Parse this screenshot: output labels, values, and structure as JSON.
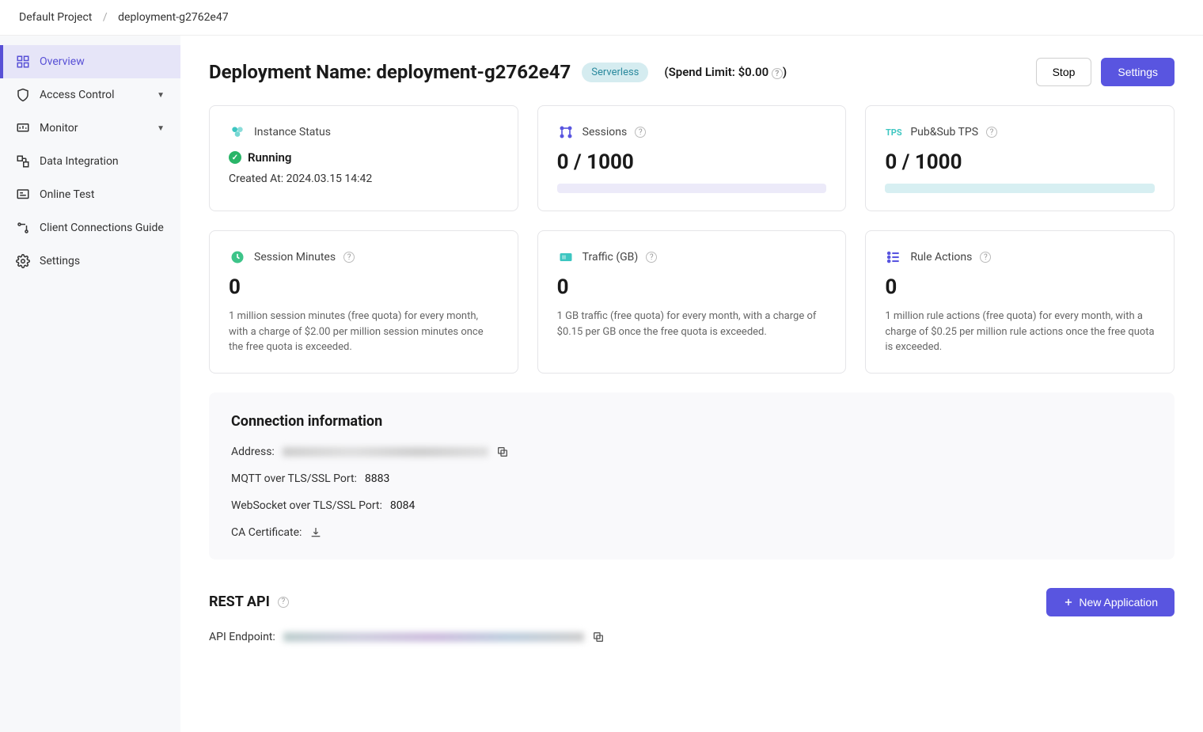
{
  "breadcrumb": {
    "project": "Default Project",
    "deployment": "deployment-g2762e47"
  },
  "sidebar": {
    "items": [
      {
        "label": "Overview"
      },
      {
        "label": "Access Control"
      },
      {
        "label": "Monitor"
      },
      {
        "label": "Data Integration"
      },
      {
        "label": "Online Test"
      },
      {
        "label": "Client Connections Guide"
      },
      {
        "label": "Settings"
      }
    ]
  },
  "header": {
    "title": "Deployment Name: deployment-g2762e47",
    "badge": "Serverless",
    "spend_limit": "(Spend Limit: $0.00",
    "spend_close": ")",
    "stop": "Stop",
    "settings": "Settings"
  },
  "cards": {
    "status": {
      "title": "Instance Status",
      "state": "Running",
      "created": "Created At: 2024.03.15 14:42"
    },
    "sessions": {
      "title": "Sessions",
      "value": "0 / 1000"
    },
    "tps": {
      "prefix": "TPS",
      "title": "Pub&Sub TPS",
      "value": "0 / 1000"
    },
    "minutes": {
      "title": "Session Minutes",
      "value": "0",
      "desc": "1 million session minutes (free quota) for every month, with a charge of $2.00 per million session minutes once the free quota is exceeded."
    },
    "traffic": {
      "title": "Traffic (GB)",
      "value": "0",
      "desc": "1 GB traffic (free quota) for every month, with a charge of $0.15 per GB once the free quota is exceeded."
    },
    "rules": {
      "title": "Rule Actions",
      "value": "0",
      "desc": "1 million rule actions (free quota) for every month, with a charge of $0.25 per million rule actions once the free quota is exceeded."
    }
  },
  "connection": {
    "title": "Connection information",
    "address_label": "Address:",
    "mqtt_label": "MQTT over TLS/SSL Port:",
    "mqtt_port": "8883",
    "ws_label": "WebSocket over TLS/SSL Port:",
    "ws_port": "8084",
    "ca_label": "CA Certificate:"
  },
  "rest": {
    "title": "REST API",
    "new_app": "New Application",
    "endpoint_label": "API Endpoint:"
  }
}
